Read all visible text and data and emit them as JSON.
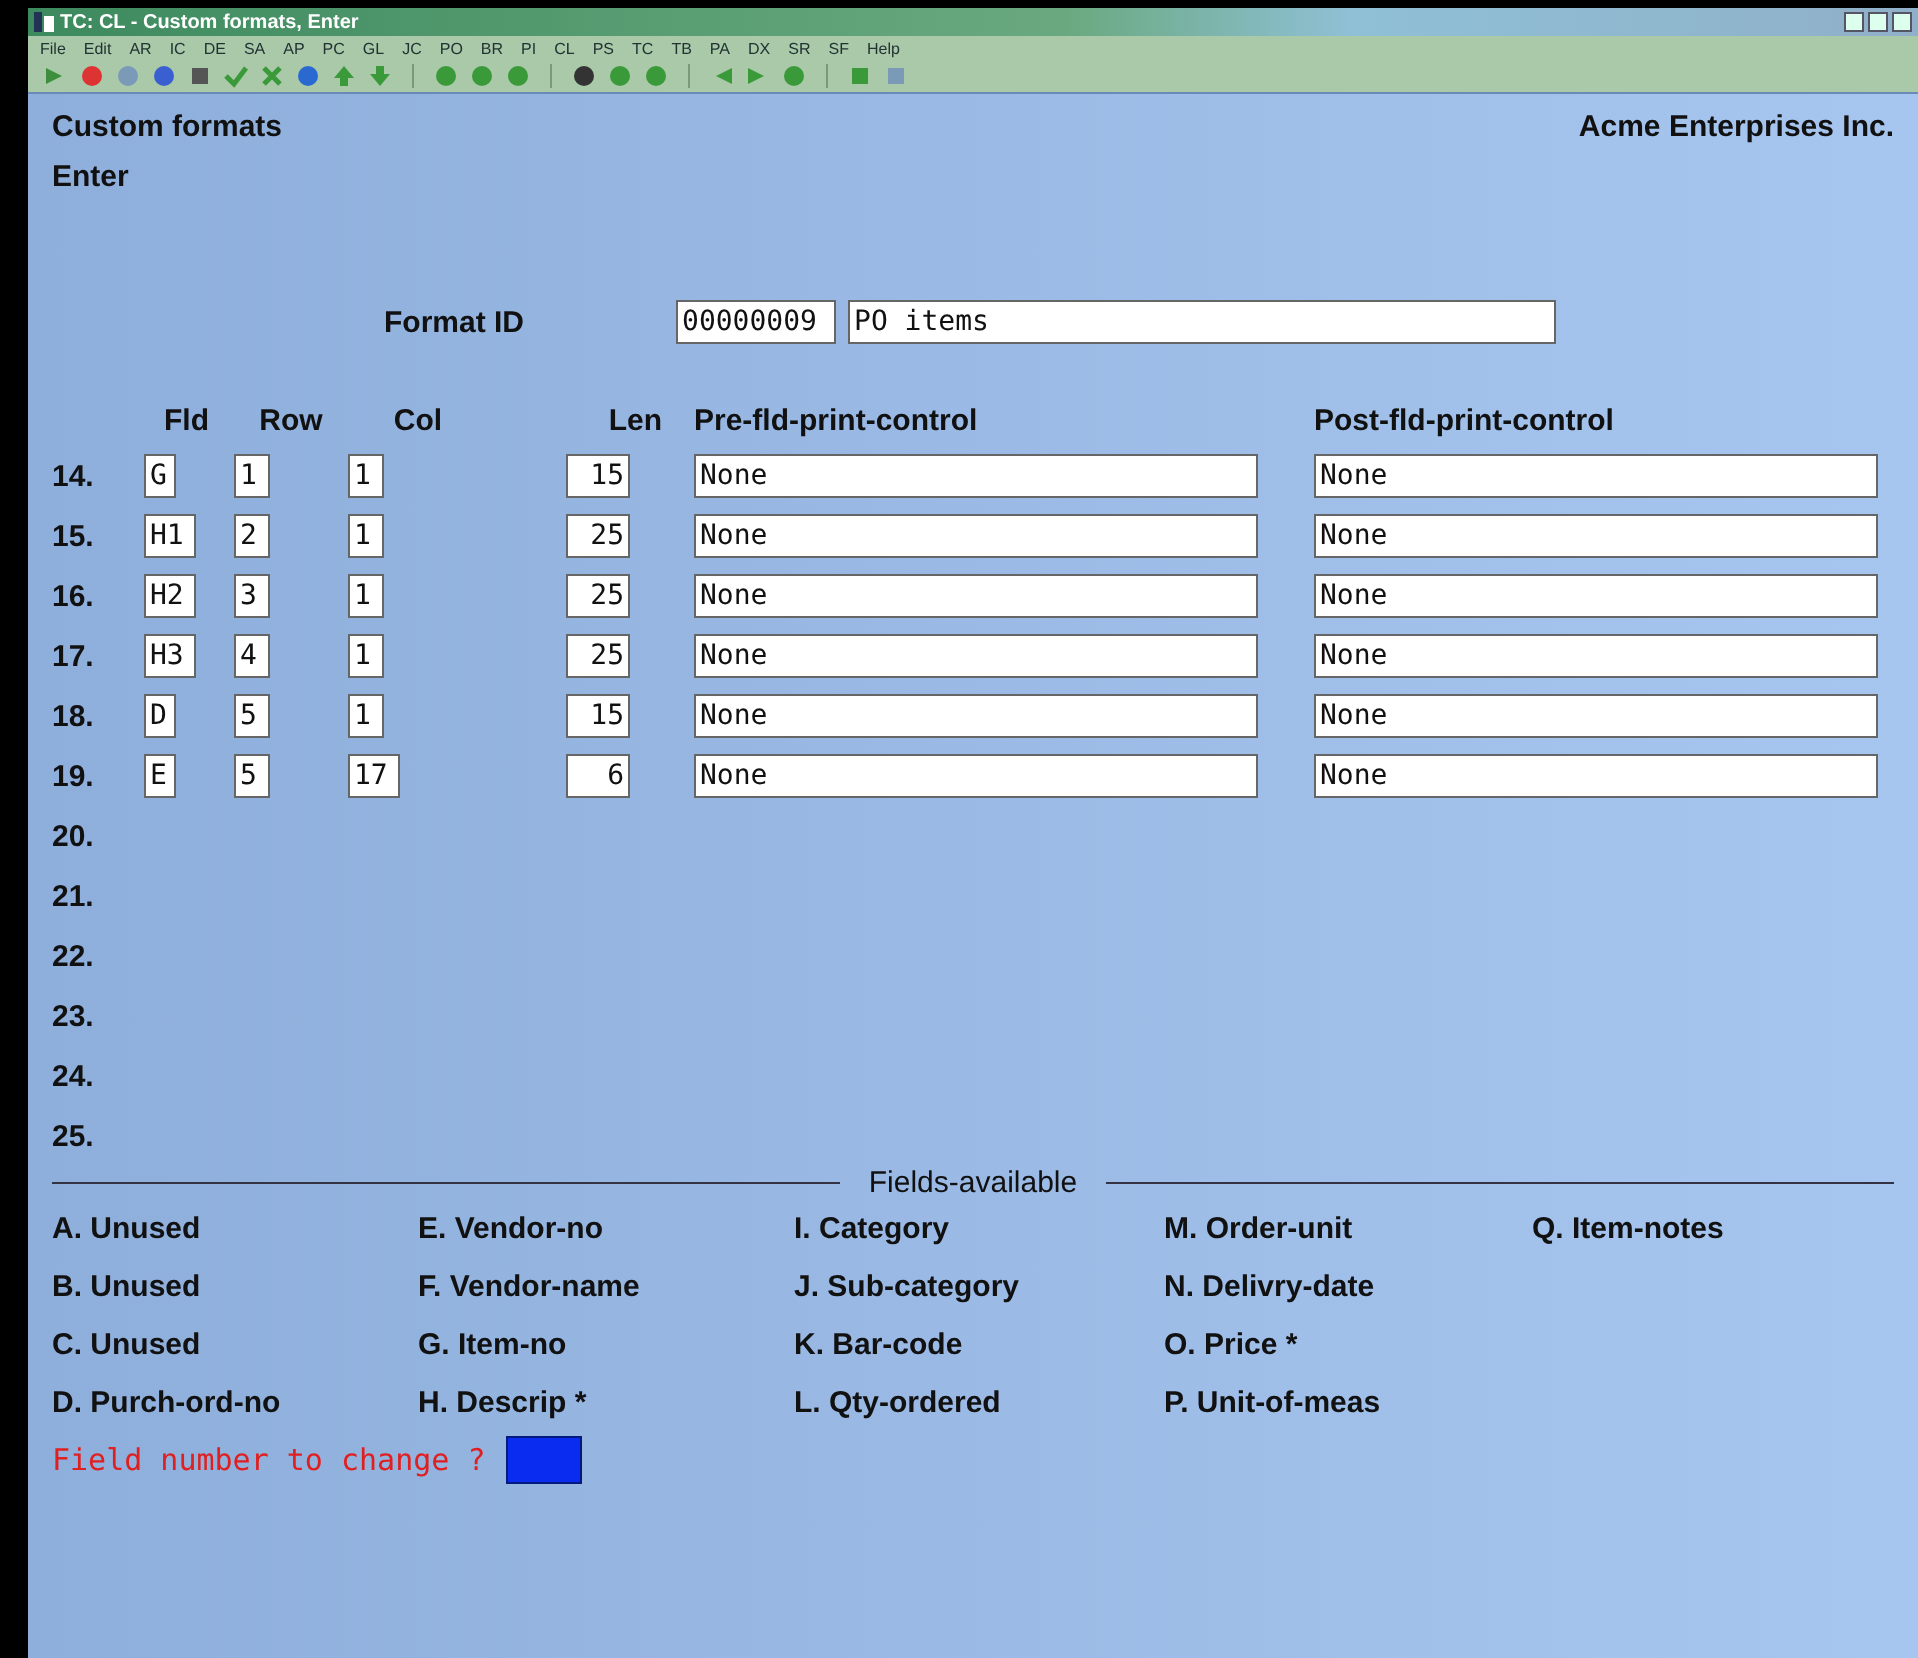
{
  "window": {
    "title": "TC: CL - Custom formats, Enter"
  },
  "menu": [
    "File",
    "Edit",
    "AR",
    "IC",
    "DE",
    "SA",
    "AP",
    "PC",
    "GL",
    "JC",
    "PO",
    "BR",
    "PI",
    "CL",
    "PS",
    "TC",
    "TB",
    "PA",
    "DX",
    "SR",
    "SF",
    "Help"
  ],
  "header": {
    "screen": "Custom formats",
    "mode": "Enter",
    "company": "Acme Enterprises Inc."
  },
  "format": {
    "label": "Format ID",
    "id": "00000009",
    "description": "PO items"
  },
  "columns": [
    "Fld",
    "Row",
    "Col",
    "Len",
    "Pre-fld-print-control",
    "Post-fld-print-control"
  ],
  "rows": [
    {
      "number": "14.",
      "fld": "G",
      "row": "1",
      "col": "1",
      "len": "15",
      "pre": "None",
      "post": "None"
    },
    {
      "number": "15.",
      "fld": "H1",
      "row": "2",
      "col": "1",
      "len": "25",
      "pre": "None",
      "post": "None"
    },
    {
      "number": "16.",
      "fld": "H2",
      "row": "3",
      "col": "1",
      "len": "25",
      "pre": "None",
      "post": "None"
    },
    {
      "number": "17.",
      "fld": "H3",
      "row": "4",
      "col": "1",
      "len": "25",
      "pre": "None",
      "post": "None"
    },
    {
      "number": "18.",
      "fld": "D",
      "row": "5",
      "col": "1",
      "len": "15",
      "pre": "None",
      "post": "None"
    },
    {
      "number": "19.",
      "fld": "E",
      "row": "5",
      "col": "17",
      "len": "6",
      "pre": "None",
      "post": "None"
    },
    {
      "number": "20."
    },
    {
      "number": "21."
    },
    {
      "number": "22."
    },
    {
      "number": "23."
    },
    {
      "number": "24."
    },
    {
      "number": "25."
    }
  ],
  "fields_available": {
    "title": "Fields-available",
    "columns": [
      [
        "A. Unused",
        "B. Unused",
        "C. Unused",
        "D. Purch-ord-no"
      ],
      [
        "E. Vendor-no",
        "F. Vendor-name",
        "G. Item-no",
        "H. Descrip *"
      ],
      [
        "I. Category",
        "J. Sub-category",
        "K. Bar-code",
        "L. Qty-ordered"
      ],
      [
        "M. Order-unit",
        "N. Delivry-date",
        "O. Price *",
        "P. Unit-of-meas"
      ],
      [
        "Q. Item-notes"
      ]
    ]
  },
  "prompt": "Field number to change ?"
}
